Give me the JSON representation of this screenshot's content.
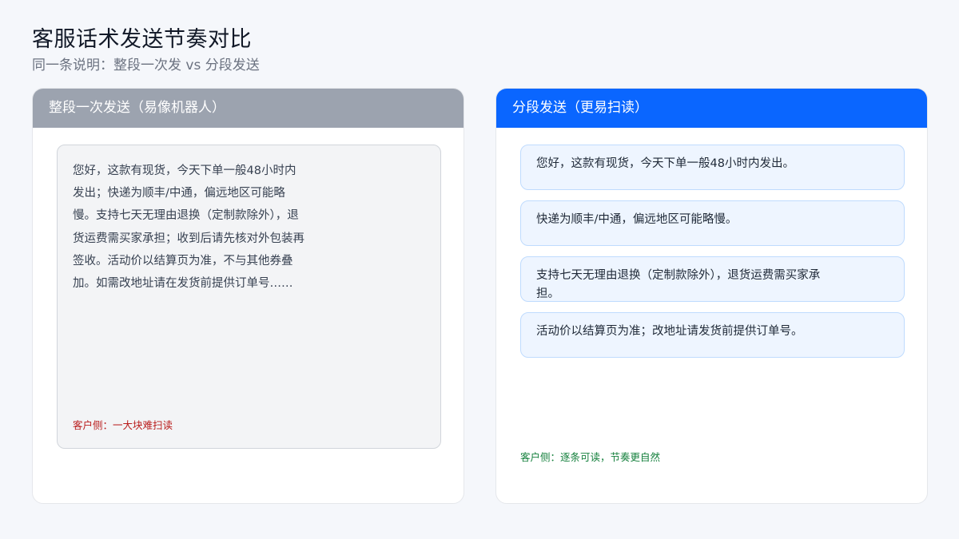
{
  "page": {
    "title": "客服话术发送节奏对比",
    "subtitle": "同一条说明：整段一次发 vs 分段发送"
  },
  "left_panel": {
    "header": "整段一次发送（易像机器人）",
    "message": "您好，这款有现货，今天下单一般48小时内发出；快递为顺丰/中通，偏远地区可能略慢。支持七天无理由退换（定制款除外），退货运费需买家承担；收到后请先核对外包装再签收。活动价以结算页为准，不与其他券叠加。如需改地址请在发货前提供订单号……",
    "note": "客户侧：一大块难扫读"
  },
  "right_panel": {
    "header": "分段发送（更易扫读）",
    "messages": [
      "您好，这款有现货，今天下单一般48小时内发出。",
      "快递为顺丰/中通，偏远地区可能略慢。",
      "支持七天无理由退换（定制款除外），退货运费需买家承担。",
      "活动价以结算页为准；改地址请发货前提供订单号。"
    ],
    "note": "客户侧：逐条可读，节奏更自然"
  },
  "colors": {
    "left_header": "#9ca3af",
    "right_header": "#0a66ff",
    "bad_note": "#b91c1c",
    "good_note": "#15803d"
  }
}
